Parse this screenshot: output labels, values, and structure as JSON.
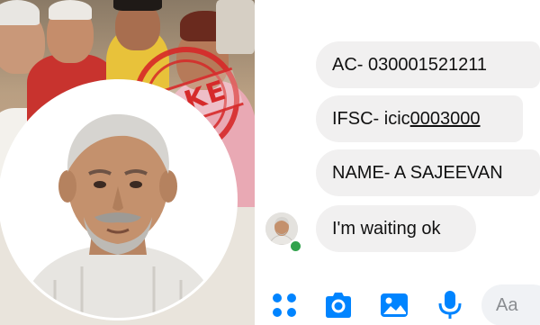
{
  "photo": {
    "stamp_text": "FAKE"
  },
  "messages": [
    {
      "prefix": "AC- 030001521211",
      "underlined": ""
    },
    {
      "prefix": "IFSC- icic",
      "underlined": "0003000"
    },
    {
      "prefix": "NAME- A SAJEEVAN",
      "underlined": ""
    },
    {
      "prefix": "I'm waiting ok",
      "underlined": ""
    }
  ],
  "composer": {
    "placeholder": "Aa"
  },
  "icons": [
    "apps-icon",
    "camera-icon",
    "image-icon",
    "mic-icon"
  ],
  "colors": {
    "accent": "#0084ff",
    "bubble": "#f1f0f0",
    "stamp": "#d62a2a",
    "online": "#31a24c"
  }
}
